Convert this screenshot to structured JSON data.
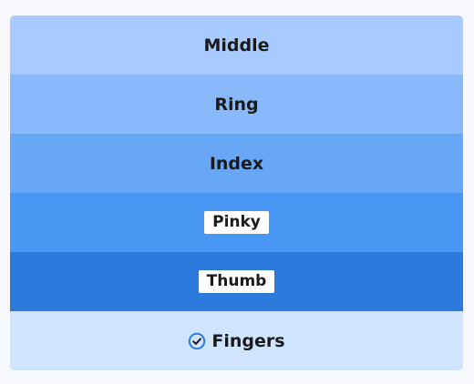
{
  "rows": [
    {
      "label": "Middle",
      "style": "plain",
      "color": "#a7cbff"
    },
    {
      "label": "Ring",
      "style": "plain",
      "color": "#89b9fb"
    },
    {
      "label": "Index",
      "style": "plain",
      "color": "#67a7f6"
    },
    {
      "label": "Pinky",
      "style": "chip",
      "color": "#4897f2"
    },
    {
      "label": "Thumb",
      "style": "chip",
      "color": "#2c7bdc"
    }
  ],
  "footer": {
    "label": "Fingers",
    "icon": "check-circle-icon",
    "color": "#cfe5ff",
    "icon_color": "#2c7bdc"
  }
}
